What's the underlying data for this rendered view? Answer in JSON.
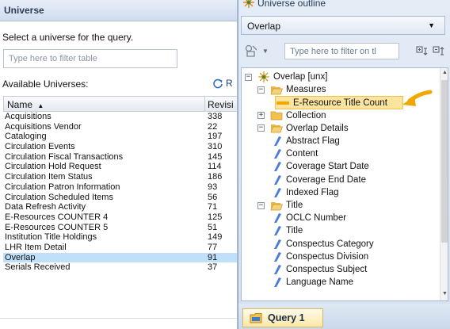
{
  "universe_panel": {
    "title": "Universe",
    "prompt": "Select a universe for the query.",
    "filter_placeholder": "Type here to filter table",
    "available_label": "Available Universes:",
    "refresh_label": "R",
    "columns": {
      "name": "Name",
      "revision": "Revisi"
    },
    "rows": [
      {
        "name": "Acquisitions",
        "revision": "338"
      },
      {
        "name": "Acquisitions Vendor",
        "revision": "22"
      },
      {
        "name": "Cataloging",
        "revision": "197"
      },
      {
        "name": "Circulation Events",
        "revision": "310"
      },
      {
        "name": "Circulation Fiscal Transactions",
        "revision": "145"
      },
      {
        "name": "Circulation Hold Request",
        "revision": "114"
      },
      {
        "name": "Circulation Item Status",
        "revision": "186"
      },
      {
        "name": "Circulation Patron Information",
        "revision": "93"
      },
      {
        "name": "Circulation Scheduled Items",
        "revision": "56"
      },
      {
        "name": "Data Refresh Activity",
        "revision": "71"
      },
      {
        "name": "E-Resources COUNTER 4",
        "revision": "125"
      },
      {
        "name": "E-Resources COUNTER 5",
        "revision": "51"
      },
      {
        "name": "Institution Title Holdings",
        "revision": "149"
      },
      {
        "name": "LHR Item Detail",
        "revision": "77"
      },
      {
        "name": "Overlap",
        "revision": "91"
      },
      {
        "name": "Serials Received",
        "revision": "37"
      }
    ],
    "selected_row": "Overlap"
  },
  "outline_panel": {
    "title": "Universe outline",
    "universe_dropdown_value": "Overlap",
    "filter_placeholder": "Type here to filter on tl",
    "tree": [
      {
        "label": "Overlap [unx]",
        "kind": "universe",
        "toggle": "−"
      },
      {
        "label": "Measures",
        "kind": "folder-open",
        "toggle": "−"
      },
      {
        "label": "E-Resource Title Count",
        "kind": "measure",
        "highlighted": true
      },
      {
        "label": "Collection",
        "kind": "folder-closed",
        "toggle": "+"
      },
      {
        "label": "Overlap Details",
        "kind": "folder-open",
        "toggle": "−"
      },
      {
        "label": "Abstract Flag",
        "kind": "dimension"
      },
      {
        "label": "Content",
        "kind": "dimension"
      },
      {
        "label": "Coverage Start Date",
        "kind": "dimension"
      },
      {
        "label": "Coverage End Date",
        "kind": "dimension"
      },
      {
        "label": "Indexed Flag",
        "kind": "dimension"
      },
      {
        "label": "Title",
        "kind": "folder-open",
        "toggle": "−"
      },
      {
        "label": "OCLC Number",
        "kind": "dimension"
      },
      {
        "label": "Title",
        "kind": "dimension"
      },
      {
        "label": "Conspectus Category",
        "kind": "dimension"
      },
      {
        "label": "Conspectus Division",
        "kind": "dimension"
      },
      {
        "label": "Conspectus Subject",
        "kind": "dimension"
      },
      {
        "label": "Language Name",
        "kind": "dimension"
      }
    ],
    "query_tab_label": "Query 1"
  },
  "colors": {
    "selected_row": "#bfe0f8",
    "highlight_fill": "#fbe49d",
    "callout_arrow": "#f0a800",
    "dimension_icon": "#4a7fd4",
    "folder": "#f2c14e"
  }
}
